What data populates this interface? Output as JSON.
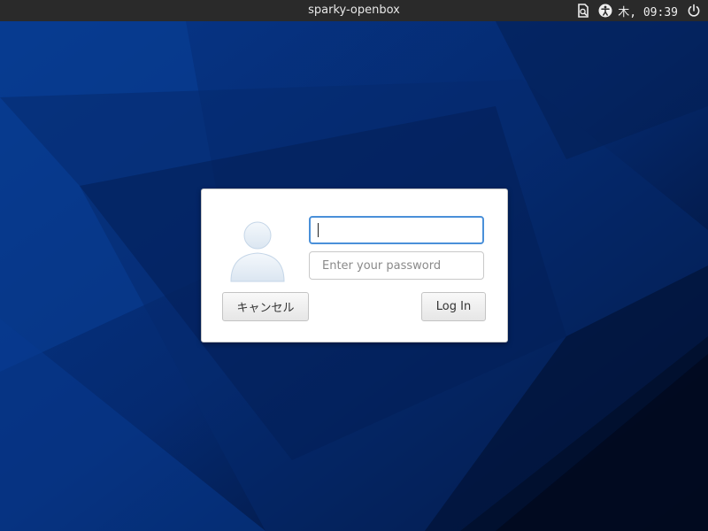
{
  "topbar": {
    "title": "sparky-openbox",
    "clock": "木, 09:39",
    "icons": [
      "document-icon",
      "accessibility-icon",
      "power-icon"
    ]
  },
  "login": {
    "username_value": "",
    "password_placeholder": "Enter your password",
    "cancel_label": "キャンセル",
    "login_label": "Log In"
  },
  "colors": {
    "topbar_bg": "#2a2a2a",
    "wallpaper_primary": "#062a6a",
    "wallpaper_dark": "#020f2e",
    "dialog_bg": "#ffffff",
    "focus_border": "#4a90d9"
  }
}
